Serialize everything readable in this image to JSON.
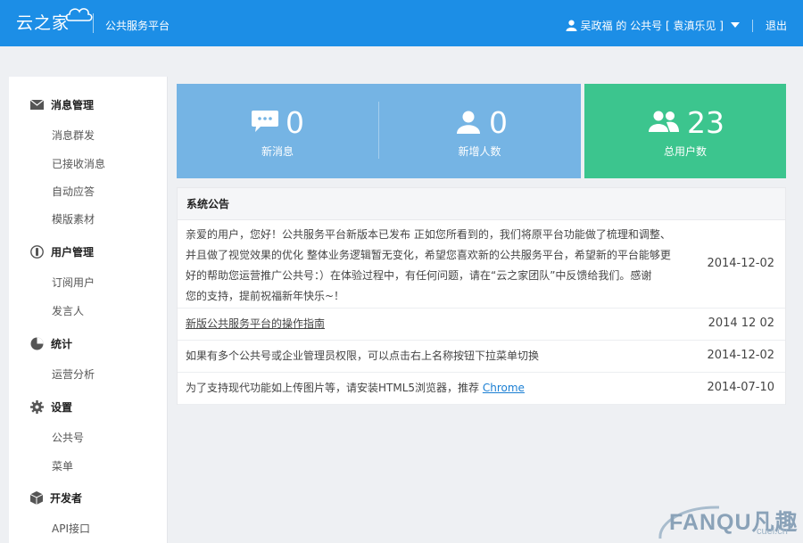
{
  "header": {
    "logo_text": "云之家",
    "platform_title": "公共服务平台",
    "user_text": "吴政福  的  公共号 [ 袁滇乐见 ]",
    "logout": "退出"
  },
  "sidebar": {
    "sections": [
      {
        "title": "消息管理",
        "icon": "envelope-icon",
        "items": [
          "消息群发",
          "已接收消息",
          "自动应答",
          "模版素材"
        ]
      },
      {
        "title": "用户管理",
        "icon": "user-circle-icon",
        "items": [
          "订阅用户",
          "发言人"
        ]
      },
      {
        "title": "统计",
        "icon": "pie-chart-icon",
        "items": [
          "运营分析"
        ]
      },
      {
        "title": "设置",
        "icon": "gear-icon",
        "items": [
          "公共号",
          "菜单"
        ]
      },
      {
        "title": "开发者",
        "icon": "cube-icon",
        "items": [
          "API接口"
        ]
      }
    ]
  },
  "stats": [
    {
      "value": "0",
      "label": "新消息",
      "icon": "chat-bubble-icon"
    },
    {
      "value": "0",
      "label": "新增人数",
      "icon": "user-icon"
    },
    {
      "value": "23",
      "label": "总用户数",
      "icon": "users-icon"
    }
  ],
  "colors": {
    "topbar": "#1c8ee6",
    "stat_blue": "#75b4e4",
    "stat_green": "#3cc58e",
    "link": "#1b7fd3"
  },
  "notice": {
    "title": "系统公告",
    "rows": [
      {
        "lines": [
          "亲爱的用户，您好！公共服务平台新版本已发布 正如您所看到的，我们将原平台功能做了梳理和调整、",
          "并且做了视觉效果的优化 整体业务逻辑暂无变化，希望您喜欢新的公共服务平台，希望新的平台能够更",
          "好的帮助您运营推广公共号：）在体验过程中，有任何问题，请在“云之家团队”中反馈给我们。感谢",
          "您的支持，提前祝福新年快乐~！"
        ],
        "date": "2014-12-02"
      },
      {
        "text": "新版公共服务平台的操作指南",
        "date": "2014 12 02"
      },
      {
        "text": "如果有多个公共号或企业管理员权限，可以点击右上名称按钮下拉菜单切换",
        "date": "2014-12-02"
      },
      {
        "text": "为了支持现代功能如上传图片等，请安装HTML5浏览器，推荐",
        "link": "Chrome",
        "date": "2014-07-10"
      }
    ]
  },
  "watermark": {
    "brand": "FANQU",
    "cn": "凡趣",
    "sub": "cuel.cn"
  }
}
